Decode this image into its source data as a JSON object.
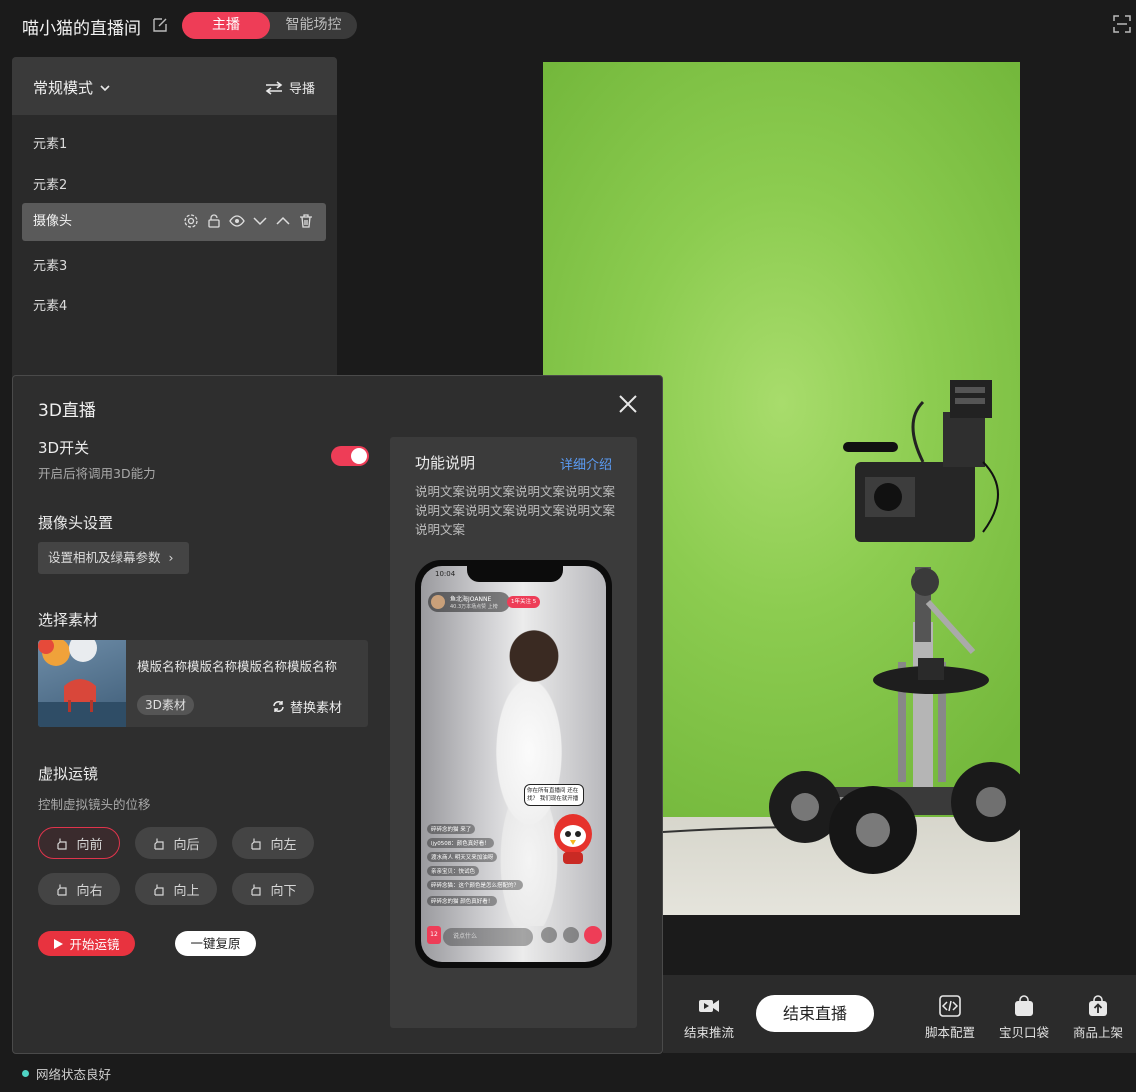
{
  "header": {
    "room_title": "喵小猫的直播间",
    "tabs": [
      "主播",
      "智能场控"
    ],
    "active_tab": "主播"
  },
  "layer_panel": {
    "mode_label": "常规模式",
    "director_label": "导播",
    "items": [
      "元素1",
      "元素2",
      "摄像头",
      "元素3",
      "元素4"
    ],
    "active_item": "摄像头",
    "active_item_actions": [
      "gear-icon",
      "lock-icon",
      "eye-icon",
      "chevron-down-icon",
      "chevron-up-icon",
      "trash-icon"
    ]
  },
  "dialog": {
    "title": "3D直播",
    "switch_section": {
      "title": "3D开关",
      "hint": "开启后将调用3D能力",
      "enabled": true
    },
    "camera_section": {
      "title": "摄像头设置",
      "button_label": "设置相机及绿幕参数"
    },
    "material_section": {
      "title": "选择素材",
      "material_name": "模版名称模版名称模版名称模版名称",
      "tag": "3D素材",
      "replace_label": "替换素材"
    },
    "virtual_camera": {
      "title": "虚拟运镜",
      "hint": "控制虚拟镜头的位移",
      "buttons": [
        "向前",
        "向后",
        "向左",
        "向右",
        "向上",
        "向下"
      ],
      "active_button": "向前",
      "start_label": "开始运镜",
      "reset_label": "一键复原"
    },
    "description": {
      "title": "功能说明",
      "link_label": "详细介绍",
      "text": "说明文案说明文案说明文案说明文案说明文案说明文案说明文案说明文案说明文案",
      "phone": {
        "time": "10:04",
        "streamer_name": "鱼北海JOANNE",
        "streamer_sub": "40.3万本场点赞 上榜",
        "follow_label": "1年关注 5",
        "bubble": "你在所有直播间 还在找？ 我们现在就开播",
        "chats": [
          "碎碎念的猫 来了",
          "ljy0508：颜色真好看！",
          "渡水商人 明天又来加油呀",
          "亲亲宝贝：快试色",
          "碎碎念猫：这个颜色是怎么搭配的？",
          "碎碎念的猫 颜色真好看！"
        ],
        "input_placeholder": "说点什么",
        "cart_count": "12"
      }
    }
  },
  "controls": {
    "stop_push_label": "结束推流",
    "end_live_label": "结束直播",
    "script_config_label": "脚本配置",
    "bag_label": "宝贝口袋",
    "listing_label": "商品上架"
  },
  "status": {
    "label": "网络状态良好",
    "color": "#4fd3c4"
  },
  "colors": {
    "accent": "#ee3d57",
    "link": "#5b9cf5",
    "green_screen": "#8ccc50"
  }
}
